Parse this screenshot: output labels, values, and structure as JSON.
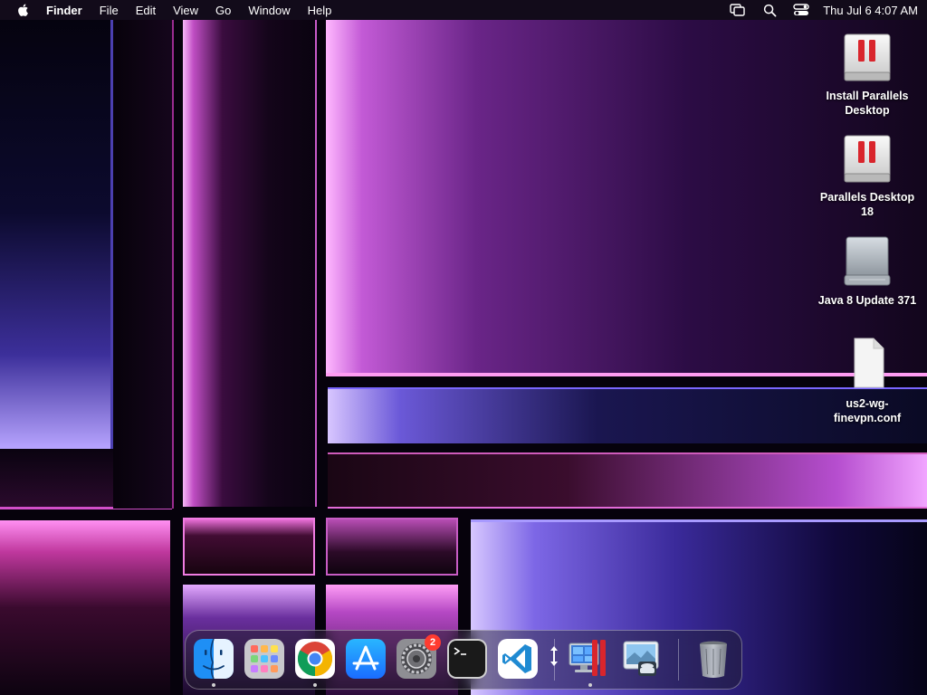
{
  "menubar": {
    "app_name": "Finder",
    "items": [
      "File",
      "Edit",
      "View",
      "Go",
      "Window",
      "Help"
    ],
    "clock": "Thu Jul 6  4:07 AM",
    "status_icons": [
      "screen-mirroring-icon",
      "spotlight-search-icon",
      "control-center-icon"
    ]
  },
  "desktop": {
    "icons": [
      {
        "label": "Install Parallels Desktop",
        "icon": "parallels-disk-icon"
      },
      {
        "label": "Parallels Desktop 18",
        "icon": "parallels-disk-icon"
      },
      {
        "label": "Java 8 Update 371",
        "icon": "external-disk-icon"
      },
      {
        "label": "us2-wg-finevpn.conf",
        "icon": "document-icon"
      }
    ]
  },
  "dock": {
    "items": [
      {
        "name": "Finder",
        "icon": "finder-icon",
        "running": true
      },
      {
        "name": "Launchpad",
        "icon": "launchpad-icon",
        "running": false
      },
      {
        "name": "Google Chrome",
        "icon": "chrome-icon",
        "running": true
      },
      {
        "name": "App Store",
        "icon": "app-store-icon",
        "running": false
      },
      {
        "name": "System Settings",
        "icon": "settings-icon",
        "running": false,
        "badge": "2"
      },
      {
        "name": "Terminal",
        "icon": "terminal-icon",
        "running": false
      },
      {
        "name": "Visual Studio Code",
        "icon": "vscode-icon",
        "running": false
      },
      {
        "name": "Parallels Desktop",
        "icon": "parallels-app-icon",
        "running": true
      },
      {
        "name": "Preview",
        "icon": "preview-icon",
        "running": false
      },
      {
        "name": "Trash",
        "icon": "trash-icon",
        "running": false
      }
    ]
  },
  "colors": {
    "parallels_red": "#d9252c",
    "badge_red": "#ff3b30",
    "vscode_blue": "#1f8ad2",
    "appstore_blue": "#1a8cff"
  }
}
